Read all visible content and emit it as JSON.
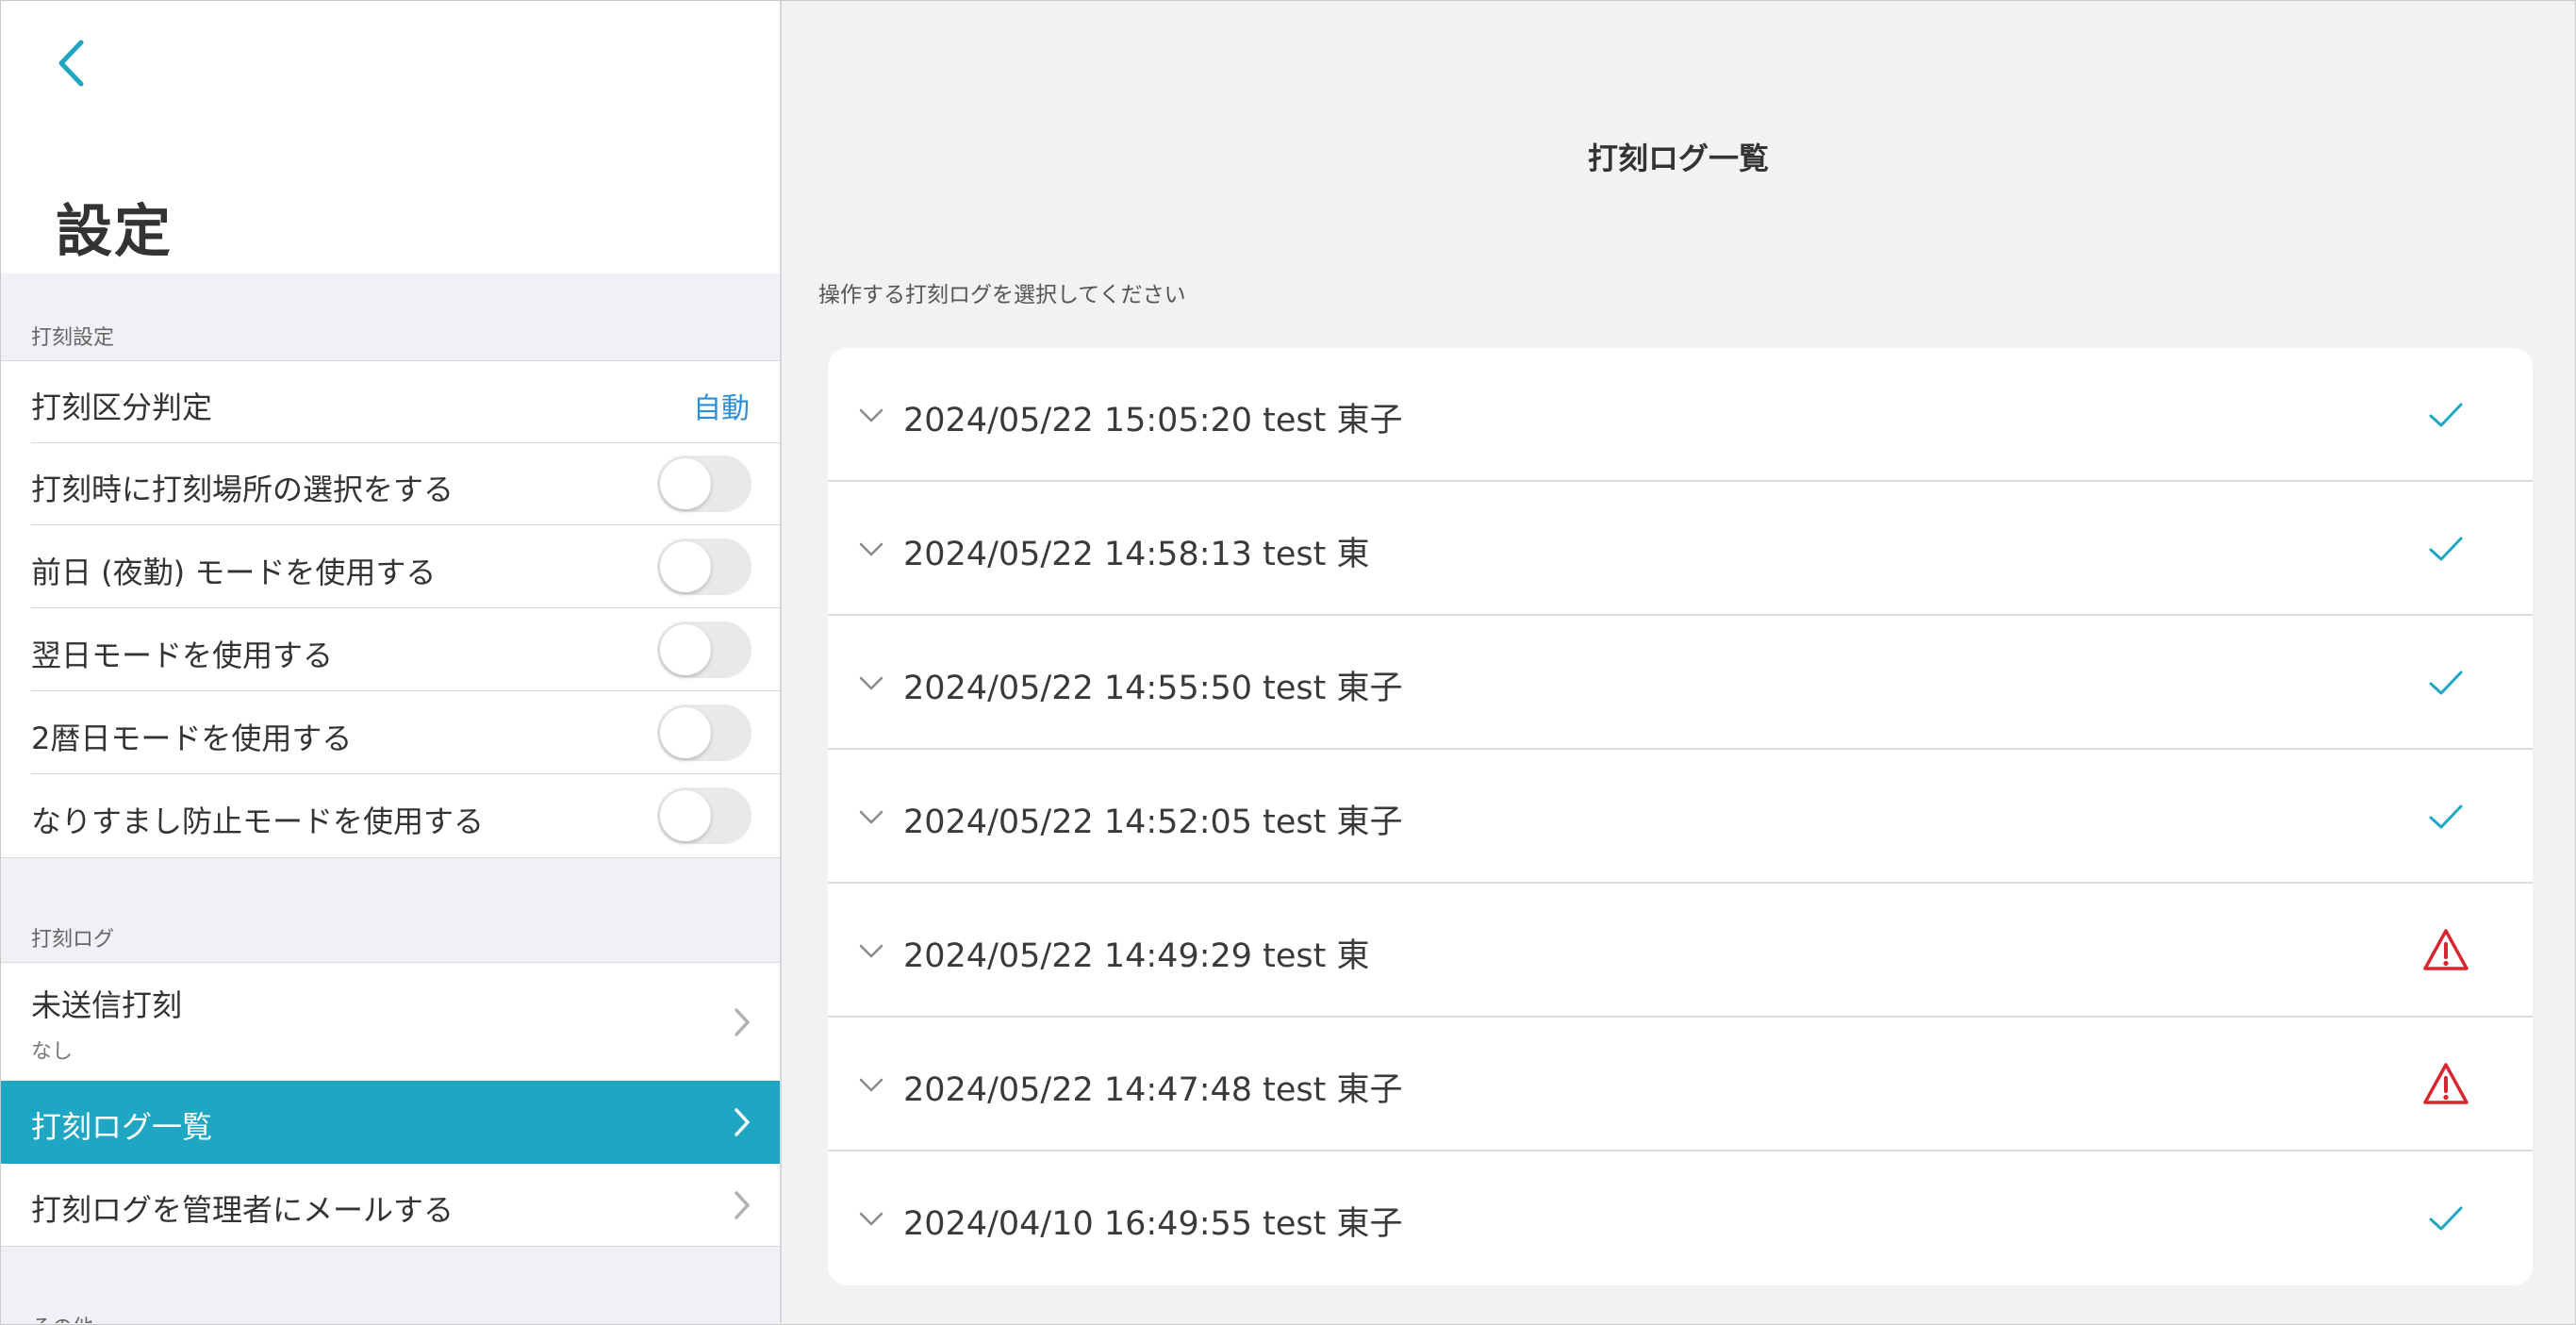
{
  "sidebar": {
    "back_icon": "chevron-left-icon",
    "title": "設定",
    "sections": {
      "punch_settings": {
        "header": "打刻設定",
        "classification_label": "打刻区分判定",
        "classification_value": "自動",
        "toggles": [
          {
            "label": "打刻時に打刻場所の選択をする",
            "on": false
          },
          {
            "label": "前日 (夜勤) モードを使用する",
            "on": false
          },
          {
            "label": "翌日モードを使用する",
            "on": false
          },
          {
            "label": "2暦日モードを使用する",
            "on": false
          },
          {
            "label": "なりすまし防止モードを使用する",
            "on": false
          }
        ]
      },
      "punch_log": {
        "header": "打刻ログ",
        "unsent_label": "未送信打刻",
        "unsent_sub": "なし",
        "log_list_label": "打刻ログ一覧",
        "mail_label": "打刻ログを管理者にメールする"
      },
      "other": {
        "header": "その他"
      }
    }
  },
  "main": {
    "title": "打刻ログ一覧",
    "instruction": "操作する打刻ログを選択してください",
    "logs": [
      {
        "text": "2024/05/22 15:05:20 test 東子",
        "status": "success"
      },
      {
        "text": "2024/05/22 14:58:13 test 東",
        "status": "success"
      },
      {
        "text": "2024/05/22 14:55:50 test 東子",
        "status": "success"
      },
      {
        "text": "2024/05/22 14:52:05 test 東子",
        "status": "success"
      },
      {
        "text": "2024/05/22 14:49:29 test 東",
        "status": "warning"
      },
      {
        "text": "2024/05/22 14:47:48 test 東子",
        "status": "warning"
      },
      {
        "text": "2024/04/10 16:49:55 test 東子",
        "status": "success"
      }
    ]
  },
  "colors": {
    "accent": "#1ea6c3",
    "link_blue": "#2d8ed8",
    "check": "#1ea6c3",
    "warning": "#d9262e"
  }
}
